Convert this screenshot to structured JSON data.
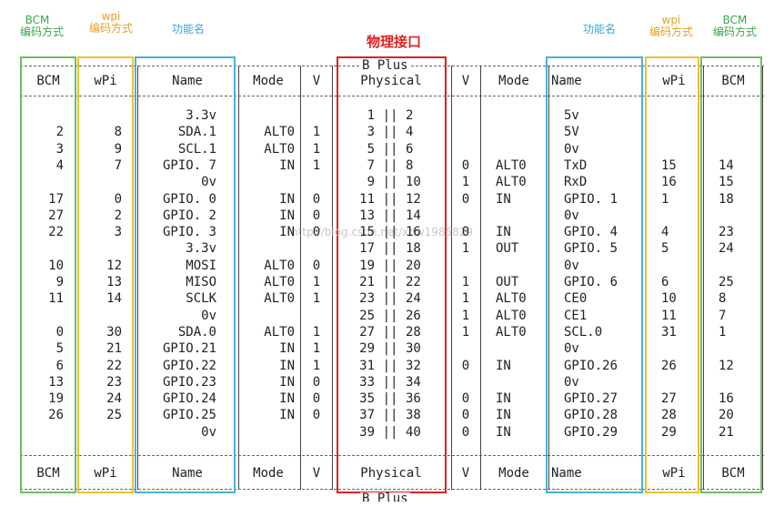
{
  "annotations": {
    "left_bcm": "BCM\n编码方式",
    "left_wpi": "wpi\n编码方式",
    "left_func": "功能名",
    "physical": "物理接口",
    "right_func": "功能名",
    "right_wpi": "wpi\n编码方式",
    "right_bcm": "BCM\n编码方式"
  },
  "board_label": "B Plus",
  "watermark": "http://blog.csdn.net/xdw1985829",
  "headers": [
    "BCM",
    "wPi",
    "Name",
    "Mode",
    "V",
    "Physical",
    "V",
    "Mode",
    "Name",
    "wPi",
    "BCM"
  ],
  "rows": [
    [
      "",
      "",
      "3.3v",
      "",
      "",
      "1",
      "2",
      "",
      "",
      "5v",
      "",
      ""
    ],
    [
      "2",
      "8",
      "SDA.1",
      "ALT0",
      "1",
      "3",
      "4",
      "",
      "",
      "5V",
      "",
      ""
    ],
    [
      "3",
      "9",
      "SCL.1",
      "ALT0",
      "1",
      "5",
      "6",
      "",
      "",
      "0v",
      "",
      ""
    ],
    [
      "4",
      "7",
      "GPIO. 7",
      "IN",
      "1",
      "7",
      "8",
      "0",
      "ALT0",
      "TxD",
      "15",
      "14"
    ],
    [
      "",
      "",
      "0v",
      "",
      "",
      "9",
      "10",
      "1",
      "ALT0",
      "RxD",
      "16",
      "15"
    ],
    [
      "17",
      "0",
      "GPIO. 0",
      "IN",
      "0",
      "11",
      "12",
      "0",
      "IN",
      "GPIO. 1",
      "1",
      "18"
    ],
    [
      "27",
      "2",
      "GPIO. 2",
      "IN",
      "0",
      "13",
      "14",
      "",
      "",
      "0v",
      "",
      ""
    ],
    [
      "22",
      "3",
      "GPIO. 3",
      "IN",
      "0",
      "15",
      "16",
      "0",
      "IN",
      "GPIO. 4",
      "4",
      "23"
    ],
    [
      "",
      "",
      "3.3v",
      "",
      "",
      "17",
      "18",
      "1",
      "OUT",
      "GPIO. 5",
      "5",
      "24"
    ],
    [
      "10",
      "12",
      "MOSI",
      "ALT0",
      "0",
      "19",
      "20",
      "",
      "",
      "0v",
      "",
      ""
    ],
    [
      "9",
      "13",
      "MISO",
      "ALT0",
      "1",
      "21",
      "22",
      "1",
      "OUT",
      "GPIO. 6",
      "6",
      "25"
    ],
    [
      "11",
      "14",
      "SCLK",
      "ALT0",
      "1",
      "23",
      "24",
      "1",
      "ALT0",
      "CE0",
      "10",
      "8"
    ],
    [
      "",
      "",
      "0v",
      "",
      "",
      "25",
      "26",
      "1",
      "ALT0",
      "CE1",
      "11",
      "7"
    ],
    [
      "0",
      "30",
      "SDA.0",
      "ALT0",
      "1",
      "27",
      "28",
      "1",
      "ALT0",
      "SCL.0",
      "31",
      "1"
    ],
    [
      "5",
      "21",
      "GPIO.21",
      "IN",
      "1",
      "29",
      "30",
      "",
      "",
      "0v",
      "",
      ""
    ],
    [
      "6",
      "22",
      "GPIO.22",
      "IN",
      "1",
      "31",
      "32",
      "0",
      "IN",
      "GPIO.26",
      "26",
      "12"
    ],
    [
      "13",
      "23",
      "GPIO.23",
      "IN",
      "0",
      "33",
      "34",
      "",
      "",
      "0v",
      "",
      ""
    ],
    [
      "19",
      "24",
      "GPIO.24",
      "IN",
      "0",
      "35",
      "36",
      "0",
      "IN",
      "GPIO.27",
      "27",
      "16"
    ],
    [
      "26",
      "25",
      "GPIO.25",
      "IN",
      "0",
      "37",
      "38",
      "0",
      "IN",
      "GPIO.28",
      "28",
      "20"
    ],
    [
      "",
      "",
      "0v",
      "",
      "",
      "39",
      "40",
      "0",
      "IN",
      "GPIO.29",
      "29",
      "21"
    ]
  ],
  "colors": {
    "bcm": "#3aa84a",
    "wpi": "#e8a020",
    "name": "#3aa6d8",
    "physical": "#e02020"
  }
}
